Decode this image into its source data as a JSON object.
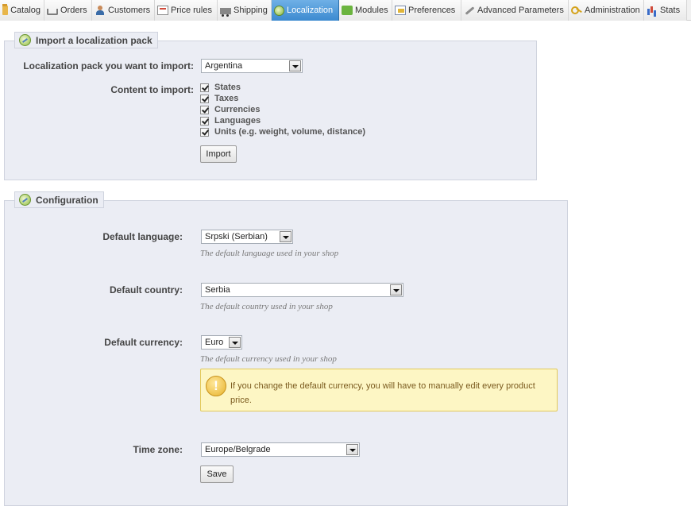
{
  "tabs": [
    {
      "label": "Catalog",
      "icon": "folder-icon",
      "active": false
    },
    {
      "label": "Orders",
      "icon": "cart-icon",
      "active": false
    },
    {
      "label": "Customers",
      "icon": "customer-icon",
      "active": false
    },
    {
      "label": "Price rules",
      "icon": "price-tag-icon",
      "active": false
    },
    {
      "label": "Shipping",
      "icon": "truck-icon",
      "active": false
    },
    {
      "label": "Localization",
      "icon": "globe-icon",
      "active": true
    },
    {
      "label": "Modules",
      "icon": "puzzle-icon",
      "active": false
    },
    {
      "label": "Preferences",
      "icon": "preferences-icon",
      "active": false
    },
    {
      "label": "Advanced Parameters",
      "icon": "wrench-icon",
      "active": false
    },
    {
      "label": "Administration",
      "icon": "key-icon",
      "active": false
    },
    {
      "label": "Stats",
      "icon": "stats-icon",
      "active": false
    }
  ],
  "import_pack": {
    "legend": "Import a localization pack",
    "pack_label": "Localization pack you want to import:",
    "pack_value": "Argentina",
    "content_label": "Content to import:",
    "options": [
      {
        "label": "States",
        "checked": true
      },
      {
        "label": "Taxes",
        "checked": true
      },
      {
        "label": "Currencies",
        "checked": true
      },
      {
        "label": "Languages",
        "checked": true
      },
      {
        "label": "Units (e.g. weight, volume, distance)",
        "checked": true
      }
    ],
    "import_button": "Import"
  },
  "configuration": {
    "legend": "Configuration",
    "language_label": "Default language:",
    "language_value": "Srpski (Serbian)",
    "language_hint": "The default language used in your shop",
    "country_label": "Default country:",
    "country_value": "Serbia",
    "country_hint": "The default country used in your shop",
    "currency_label": "Default currency:",
    "currency_value": "Euro",
    "currency_hint": "The default currency used in your shop",
    "currency_warning": "If you change the default currency, you will have to manually edit every product price.",
    "timezone_label": "Time zone:",
    "timezone_value": "Europe/Belgrade",
    "save_button": "Save"
  },
  "colors": {
    "active_tab": "#3c8ad0",
    "panel_bg": "#ebedf4",
    "warning_bg": "#fdf6c4"
  }
}
